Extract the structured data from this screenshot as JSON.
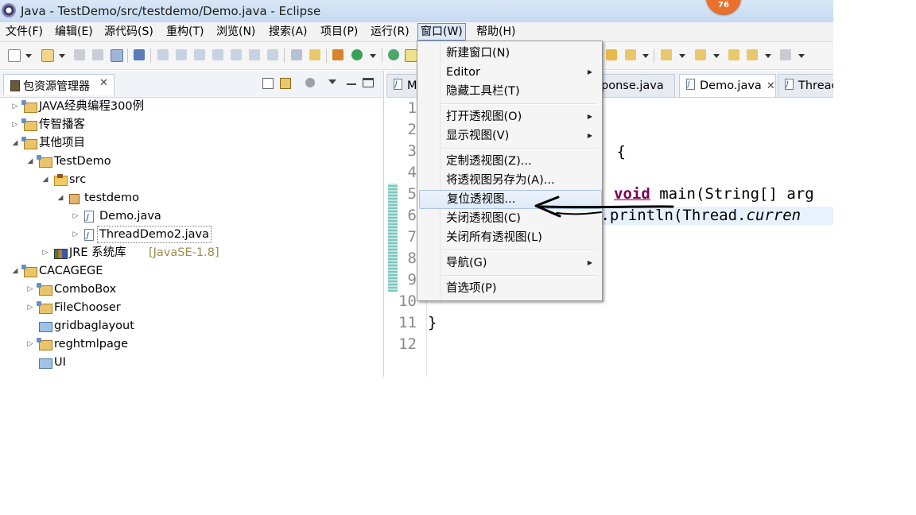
{
  "window": {
    "title": "Java  -  TestDemo/src/testdemo/Demo.java  -  Eclipse",
    "notification_count": "76"
  },
  "menubar": {
    "items": [
      "文件(F)",
      "编辑(E)",
      "源代码(S)",
      "重构(T)",
      "浏览(N)",
      "搜索(A)",
      "项目(P)",
      "运行(R)",
      "窗口(W)",
      "帮助(H)"
    ],
    "active": "窗口(W)"
  },
  "package_explorer": {
    "tab_label": "包资源管理器",
    "close_glyph": "✕",
    "tree": [
      {
        "label": "JAVA经典编程300例",
        "type": "project",
        "level": 0,
        "expanded": false
      },
      {
        "label": "传智播客",
        "type": "project",
        "level": 0,
        "expanded": false
      },
      {
        "label": "其他项目",
        "type": "project",
        "level": 0,
        "expanded": true
      },
      {
        "label": "TestDemo",
        "type": "project",
        "level": 1,
        "expanded": true
      },
      {
        "label": "src",
        "type": "srcfolder",
        "level": 2,
        "expanded": true
      },
      {
        "label": "testdemo",
        "type": "package",
        "level": 3,
        "expanded": true
      },
      {
        "label": "Demo.java",
        "type": "javafile",
        "level": 4,
        "expanded": false
      },
      {
        "label": "ThreadDemo2.java",
        "type": "javafile",
        "level": 4,
        "expanded": false,
        "selected": true
      },
      {
        "label": "JRE 系统库",
        "decoration": "[JavaSE-1.8]",
        "type": "lib",
        "level": 2,
        "expanded": false
      },
      {
        "label": "CACAGEGE",
        "type": "project",
        "level": 0,
        "expanded": true
      },
      {
        "label": "ComboBox",
        "type": "project",
        "level": 1,
        "expanded": false
      },
      {
        "label": "FileChooser",
        "type": "project",
        "level": 1,
        "expanded": false
      },
      {
        "label": "gridbaglayout",
        "type": "plainfolder",
        "level": 1,
        "expanded": null
      },
      {
        "label": "reghtmlpage",
        "type": "project",
        "level": 1,
        "expanded": false
      },
      {
        "label": "UI",
        "type": "plainfolder",
        "level": 1,
        "expanded": null
      }
    ]
  },
  "editor": {
    "tabs": [
      {
        "label": "M",
        "active": false
      },
      {
        "label": "ponse.java",
        "active": false
      },
      {
        "label": "Demo.java",
        "active": true
      },
      {
        "label": "Threac",
        "active": false
      }
    ],
    "line_numbers": [
      "1",
      "2",
      "3",
      "4",
      "5",
      "6",
      "7",
      "8",
      "9",
      "10",
      "11",
      "12"
    ],
    "code": {
      "line3": " {",
      "line5_kw": "void",
      "line5_rest": " main(String[] arg",
      "line6_pre": "t",
      "line6_mid": ".println(Thread.",
      "line6_it": "curren",
      "line11": "}"
    }
  },
  "window_menu": {
    "items": [
      {
        "label": "新建窗口(N)",
        "submenu": false
      },
      {
        "label": "Editor",
        "submenu": true
      },
      {
        "label": "隐藏工具栏(T)",
        "submenu": false
      },
      {
        "label": "打开透视图(O)",
        "submenu": true
      },
      {
        "label": "显示视图(V)",
        "submenu": true
      },
      {
        "label": "定制透视图(Z)...",
        "submenu": false
      },
      {
        "label": "将透视图另存为(A)...",
        "submenu": false
      },
      {
        "label": "复位透视图...",
        "submenu": false,
        "highlighted": true
      },
      {
        "label": "关闭透视图(C)",
        "submenu": false
      },
      {
        "label": "关闭所有透视图(L)",
        "submenu": false
      },
      {
        "label": "导航(G)",
        "submenu": true
      },
      {
        "label": "首选项(P)",
        "submenu": false
      }
    ],
    "submenu_glyph": "▶"
  },
  "colors": {
    "keyword": "#7f0055",
    "menu_highlight": "#dde9f8",
    "annotation_arrow": "#000000"
  }
}
